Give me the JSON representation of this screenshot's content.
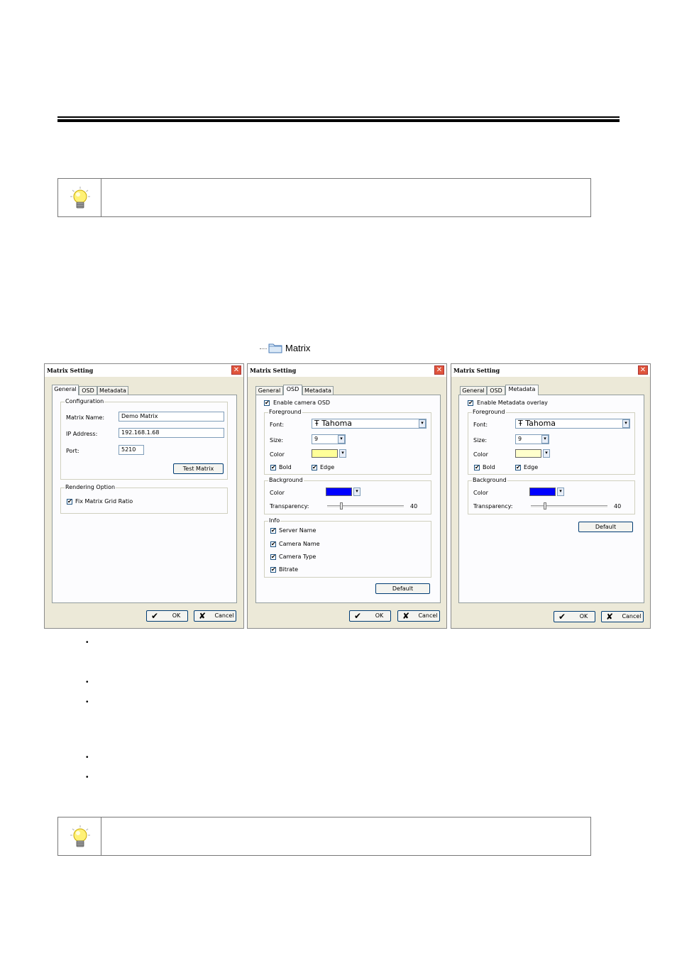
{
  "tree_item": {
    "label": "Matrix",
    "icon": "folder-icon"
  },
  "notes": [
    {
      "icon": "lightbulb-icon"
    },
    {
      "icon": "lightbulb-icon"
    }
  ],
  "dialogs": [
    {
      "title": "Matrix Setting",
      "tabs": [
        "General",
        "OSD",
        "Metadata"
      ],
      "active_tab": "General",
      "configuration": {
        "label": "Configuration",
        "matrix_name_label": "Matrix Name:",
        "matrix_name_value": "Demo Matrix",
        "ip_label": "IP Address:",
        "ip_value": "192.168.1.68",
        "port_label": "Port:",
        "port_value": "5210",
        "test_button": "Test Matrix"
      },
      "rendering": {
        "label": "Rendering Option",
        "fix_ratio_label": "Fix Matrix Grid Ratio",
        "fix_ratio_checked": true
      },
      "ok_label": "OK",
      "cancel_label": "Cancel"
    },
    {
      "title": "Matrix Setting",
      "tabs": [
        "General",
        "OSD",
        "Metadata"
      ],
      "active_tab": "OSD",
      "enable_label": "Enable camera OSD",
      "foreground": {
        "label": "Foreground",
        "font_label": "Font:",
        "font_value": "Tahoma",
        "size_label": "Size:",
        "size_value": "9",
        "color_label": "Color",
        "color_value": "#ffff99",
        "bold_label": "Bold",
        "edge_label": "Edge"
      },
      "background": {
        "label": "Background",
        "color_label": "Color",
        "color_value": "#0000ff",
        "transparency_label": "Transparency:",
        "transparency_value": "40"
      },
      "info": {
        "label": "Info",
        "items": [
          "Server Name",
          "Camera Name",
          "Camera Type",
          "Bitrate"
        ]
      },
      "default_button": "Default",
      "ok_label": "OK",
      "cancel_label": "Cancel"
    },
    {
      "title": "Matrix Setting",
      "tabs": [
        "General",
        "OSD",
        "Metadata"
      ],
      "active_tab": "Metadata",
      "enable_label": "Enable Metadata overlay",
      "foreground": {
        "label": "Foreground",
        "font_label": "Font:",
        "font_value": "Tahoma",
        "size_label": "Size:",
        "size_value": "9",
        "color_label": "Color",
        "color_value": "#ffffcc",
        "bold_label": "Bold",
        "edge_label": "Edge"
      },
      "background": {
        "label": "Background",
        "color_label": "Color",
        "color_value": "#0000ff",
        "transparency_label": "Transparency:",
        "transparency_value": "40"
      },
      "default_button": "Default",
      "ok_label": "OK",
      "cancel_label": "Cancel"
    }
  ],
  "bullets": [
    "•",
    "•",
    "•",
    "•",
    "•"
  ],
  "glyphs": {
    "check": "✔",
    "cancel_x": "✘",
    "close_x": "✕",
    "dropdown": "▾",
    "font_symbol": "Ŧ"
  }
}
